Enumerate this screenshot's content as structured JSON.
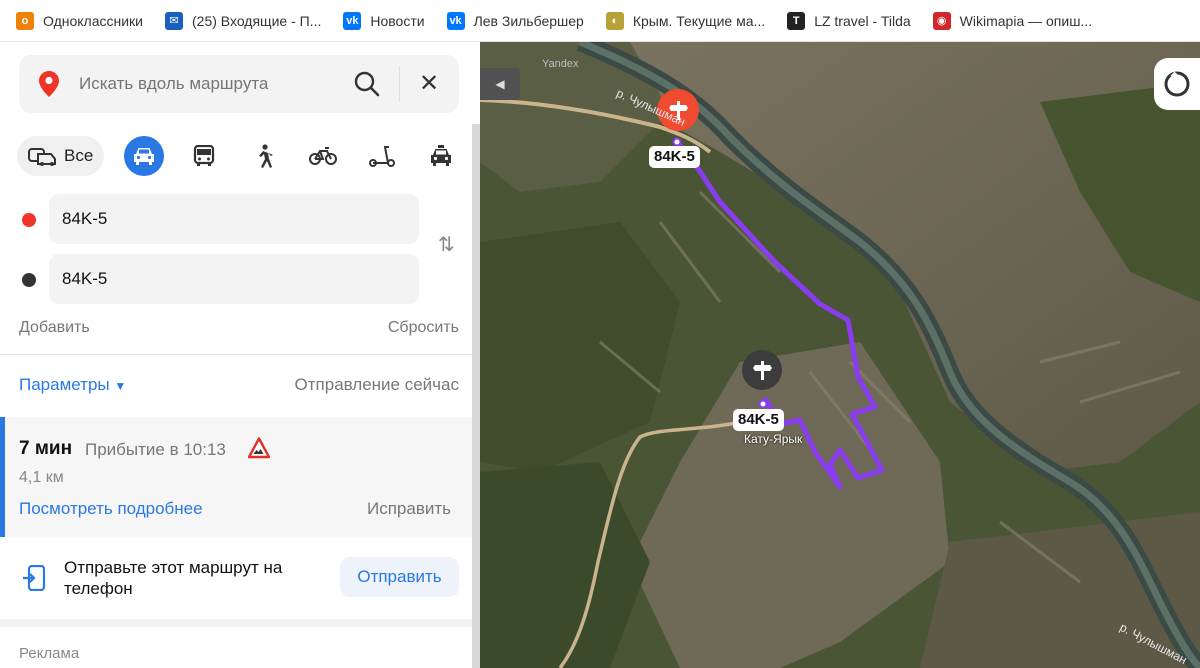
{
  "bookmarks": [
    {
      "label": "Одноклассники",
      "icon": "odnoklassniki-icon",
      "color": "#ee8208",
      "glyph": "о"
    },
    {
      "label": "(25) Входящие - П...",
      "icon": "mail-icon",
      "color": "#1b5fbe",
      "glyph": "✉"
    },
    {
      "label": "Новости",
      "icon": "vk-icon",
      "color": "#0077ff",
      "glyph": "vk"
    },
    {
      "label": "Лев Зильбершер",
      "icon": "vk-icon",
      "color": "#0077ff",
      "glyph": "vk"
    },
    {
      "label": "Крым. Текущие ма...",
      "icon": "crimea-icon",
      "color": "#b9a13a",
      "glyph": "◐"
    },
    {
      "label": "LZ travel - Tilda",
      "icon": "tilda-icon",
      "color": "#222222",
      "glyph": "T"
    },
    {
      "label": "Wikimapia — опиш...",
      "icon": "wikimapia-icon",
      "color": "#d1262a",
      "glyph": "◉"
    }
  ],
  "search": {
    "placeholder": "Искать вдоль маршрута"
  },
  "modes": {
    "all_label": "Все",
    "items": [
      "car-icon",
      "bus-icon",
      "pedestrian-icon",
      "bicycle-icon",
      "scooter-icon",
      "taxi-icon"
    ],
    "active": "car-icon"
  },
  "waypoints": [
    {
      "value": "84K-5",
      "color": "#f0342a"
    },
    {
      "value": "84K-5",
      "color": "#333333"
    }
  ],
  "actions": {
    "add": "Добавить",
    "reset": "Сбросить"
  },
  "options": {
    "params": "Параметры",
    "departure": "Отправление сейчас"
  },
  "route": {
    "time": "7 мин",
    "arrival": "Прибытие в 10:13",
    "distance": "4,1 км",
    "details": "Посмотреть подробнее",
    "fix": "Исправить"
  },
  "send": {
    "text": "Отправьте этот маршрут на телефон",
    "button": "Отправить"
  },
  "ad": {
    "label": "Реклама"
  },
  "map": {
    "watermark": "Yandex",
    "river_labels": [
      "р. Чулышман",
      "р. Чулышман"
    ],
    "start_label": "84K-5",
    "end_label": "84K-5",
    "place_label": "Кату-Ярык",
    "route_color": "#8a3cf0"
  }
}
